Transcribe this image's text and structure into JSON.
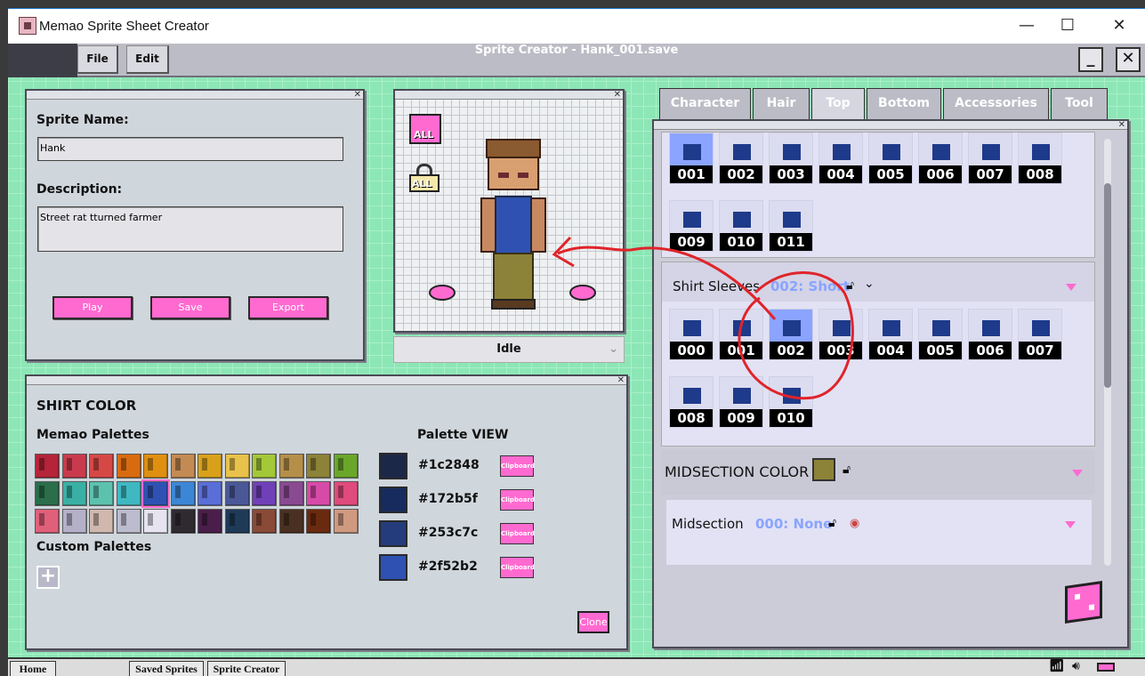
{
  "window": {
    "title": "Memao Sprite Sheet Creator",
    "minimize": "—",
    "maximize": "☐",
    "close": "✕"
  },
  "menubar": {
    "file": "File",
    "edit": "Edit",
    "title": "Sprite Creator - Hank_001.save",
    "min": "_",
    "close": "✕"
  },
  "info": {
    "name_label": "Sprite Name:",
    "name_value": "Hank",
    "desc_label": "Description:",
    "desc_value": "Street rat tturned farmer",
    "play": "Play",
    "save": "Save",
    "export": "Export"
  },
  "preview": {
    "all_label": "ALL",
    "animation": "Idle"
  },
  "color": {
    "title": "SHIRT COLOR",
    "palettes_label": "Memao Palettes",
    "custom_label": "Custom Palettes",
    "view_label": "Palette VIEW",
    "clone": "Clone",
    "rows": [
      [
        "#b5243a",
        "#c93b4c",
        "#d64846",
        "#d86b10",
        "#e08f10",
        "#c48a54",
        "#d9a11a",
        "#e8c24a",
        "#a3c838",
        "#b58f4a",
        "#8c8238",
        "#6aa62a"
      ],
      [
        "#2a6e4a",
        "#3ab0a4",
        "#5cc2ae",
        "#3fb8c2",
        "#2f52b2",
        "#3d86d6",
        "#5a6ed8",
        "#4a5898",
        "#7040b8",
        "#8a4a92",
        "#d84aa8",
        "#e04a7c"
      ],
      [
        "#e0607a",
        "#b4b0c8",
        "#d0b8ae",
        "#bcbcce",
        "#e6e4f0",
        "#2e2a30",
        "#4a1e4a",
        "#1e3a58",
        "#8a4a38",
        "#4a3020",
        "#6a2a10",
        "#d09a80"
      ]
    ],
    "view": [
      {
        "hex": "#1c2848",
        "clip": "Clipboard"
      },
      {
        "hex": "#172b5f",
        "clip": "Clipboard"
      },
      {
        "hex": "#253c7c",
        "clip": "Clipboard"
      },
      {
        "hex": "#2f52b2",
        "clip": "Clipboard"
      }
    ]
  },
  "tabs": [
    {
      "label": "Character"
    },
    {
      "label": "Hair"
    },
    {
      "label": "Top"
    },
    {
      "label": "Bottom"
    },
    {
      "label": "Accessories"
    },
    {
      "label": "Tool"
    }
  ],
  "shirts": [
    "001",
    "002",
    "003",
    "004",
    "005",
    "006",
    "007",
    "008",
    "009",
    "010",
    "011"
  ],
  "sleeves": {
    "label": "Shirt Sleeves",
    "value": "002: Short",
    "items": [
      "000",
      "001",
      "002",
      "003",
      "004",
      "005",
      "006",
      "007",
      "008",
      "009",
      "010"
    ]
  },
  "midcolor": {
    "label": "MIDSECTION COLOR",
    "color": "#8c8238"
  },
  "midsection": {
    "label": "Midsection",
    "value": "000: None"
  },
  "taskbar": {
    "home": "Home",
    "saved": "Saved Sprites",
    "creator": "Sprite Creator"
  }
}
